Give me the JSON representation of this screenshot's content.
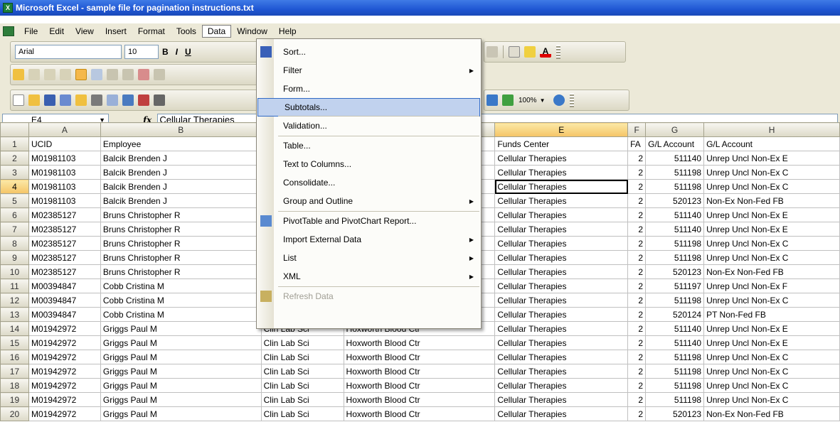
{
  "window": {
    "title": "Microsoft Excel - sample file for pagination instructions.txt",
    "app_icon": "X"
  },
  "menubar": {
    "items": [
      "File",
      "Edit",
      "View",
      "Insert",
      "Format",
      "Tools",
      "Data",
      "Window",
      "Help"
    ],
    "open": "Data"
  },
  "toolbar": {
    "font_name": "Arial",
    "font_size": "10",
    "bold": "B",
    "italic": "I",
    "underline": "U",
    "zoom": "100%"
  },
  "formula_bar": {
    "name_box": "E4",
    "fx": "fx",
    "value": "Cellular Therapies"
  },
  "data_menu": {
    "items": [
      {
        "label": "Sort...",
        "has_submenu": false,
        "enabled": true,
        "icon": "sort-icon"
      },
      {
        "label": "Filter",
        "has_submenu": true,
        "enabled": true
      },
      {
        "label": "Form...",
        "has_submenu": false,
        "enabled": true
      },
      {
        "label": "Subtotals...",
        "has_submenu": false,
        "enabled": true,
        "highlighted": true
      },
      {
        "label": "Validation...",
        "has_submenu": false,
        "enabled": true
      },
      {
        "label": "Table...",
        "has_submenu": false,
        "enabled": true
      },
      {
        "label": "Text to Columns...",
        "has_submenu": false,
        "enabled": true
      },
      {
        "label": "Consolidate...",
        "has_submenu": false,
        "enabled": true
      },
      {
        "label": "Group and Outline",
        "has_submenu": true,
        "enabled": true
      },
      {
        "label": "PivotTable and PivotChart Report...",
        "has_submenu": false,
        "enabled": true,
        "icon": "pivot-icon"
      },
      {
        "label": "Import External Data",
        "has_submenu": true,
        "enabled": true
      },
      {
        "label": "List",
        "has_submenu": true,
        "enabled": true
      },
      {
        "label": "XML",
        "has_submenu": true,
        "enabled": true
      },
      {
        "label": "Refresh Data",
        "has_submenu": false,
        "enabled": false,
        "icon": "refresh-icon"
      }
    ]
  },
  "sheet": {
    "columns": [
      "A",
      "B",
      "C",
      "D",
      "E",
      "F",
      "G",
      "H"
    ],
    "selected_column": "E",
    "selected_row": "4",
    "rows": [
      [
        "1",
        "UCID",
        "Employee",
        "",
        "",
        "Funds Center",
        "FA",
        "G/L Account",
        "G/L Account"
      ],
      [
        "2",
        "M01981103",
        "Balcik Brenden J",
        "",
        "",
        "Cellular Therapies",
        "2",
        "511140",
        "Unrep Uncl Non-Ex E"
      ],
      [
        "3",
        "M01981103",
        "Balcik Brenden J",
        "",
        "",
        "Cellular Therapies",
        "2",
        "511198",
        "Unrep Uncl Non-Ex C"
      ],
      [
        "4",
        "M01981103",
        "Balcik Brenden J",
        "",
        "",
        "Cellular Therapies",
        "2",
        "511198",
        "Unrep Uncl Non-Ex C"
      ],
      [
        "5",
        "M01981103",
        "Balcik Brenden J",
        "",
        "",
        "Cellular Therapies",
        "2",
        "520123",
        "Non-Ex Non-Fed FB"
      ],
      [
        "6",
        "M02385127",
        "Bruns Christopher R",
        "",
        "",
        "Cellular Therapies",
        "2",
        "511140",
        "Unrep Uncl Non-Ex E"
      ],
      [
        "7",
        "M02385127",
        "Bruns Christopher R",
        "",
        "",
        "Cellular Therapies",
        "2",
        "511140",
        "Unrep Uncl Non-Ex E"
      ],
      [
        "8",
        "M02385127",
        "Bruns Christopher R",
        "",
        "",
        "Cellular Therapies",
        "2",
        "511198",
        "Unrep Uncl Non-Ex C"
      ],
      [
        "9",
        "M02385127",
        "Bruns Christopher R",
        "",
        "",
        "Cellular Therapies",
        "2",
        "511198",
        "Unrep Uncl Non-Ex C"
      ],
      [
        "10",
        "M02385127",
        "Bruns Christopher R",
        "",
        "",
        "Cellular Therapies",
        "2",
        "520123",
        "Non-Ex Non-Fed FB"
      ],
      [
        "11",
        "M00394847",
        "Cobb Cristina M",
        "",
        "",
        "Cellular Therapies",
        "2",
        "511197",
        "Unrep Uncl Non-Ex F"
      ],
      [
        "12",
        "M00394847",
        "Cobb Cristina M",
        "",
        "",
        "Cellular Therapies",
        "2",
        "511198",
        "Unrep Uncl Non-Ex C"
      ],
      [
        "13",
        "M00394847",
        "Cobb Cristina M",
        "",
        "",
        "Cellular Therapies",
        "2",
        "520124",
        "PT Non-Fed FB"
      ],
      [
        "14",
        "M01942972",
        "Griggs Paul M",
        "Clin Lab Sci",
        "Hoxworth Blood Ctr",
        "Cellular Therapies",
        "2",
        "511140",
        "Unrep Uncl Non-Ex E"
      ],
      [
        "15",
        "M01942972",
        "Griggs Paul M",
        "Clin Lab Sci",
        "Hoxworth Blood Ctr",
        "Cellular Therapies",
        "2",
        "511140",
        "Unrep Uncl Non-Ex E"
      ],
      [
        "16",
        "M01942972",
        "Griggs Paul M",
        "Clin Lab Sci",
        "Hoxworth Blood Ctr",
        "Cellular Therapies",
        "2",
        "511198",
        "Unrep Uncl Non-Ex C"
      ],
      [
        "17",
        "M01942972",
        "Griggs Paul M",
        "Clin Lab Sci",
        "Hoxworth Blood Ctr",
        "Cellular Therapies",
        "2",
        "511198",
        "Unrep Uncl Non-Ex C"
      ],
      [
        "18",
        "M01942972",
        "Griggs Paul M",
        "Clin Lab Sci",
        "Hoxworth Blood Ctr",
        "Cellular Therapies",
        "2",
        "511198",
        "Unrep Uncl Non-Ex C"
      ],
      [
        "19",
        "M01942972",
        "Griggs Paul M",
        "Clin Lab Sci",
        "Hoxworth Blood Ctr",
        "Cellular Therapies",
        "2",
        "511198",
        "Unrep Uncl Non-Ex C"
      ],
      [
        "20",
        "M01942972",
        "Griggs Paul M",
        "Clin Lab Sci",
        "Hoxworth Blood Ctr",
        "Cellular Therapies",
        "2",
        "520123",
        "Non-Ex Non-Fed FB"
      ]
    ]
  },
  "colors": {
    "titlebar": "#1f56d3",
    "menu_highlight": "#c1d2ee",
    "header_selected": "#f5c466"
  }
}
